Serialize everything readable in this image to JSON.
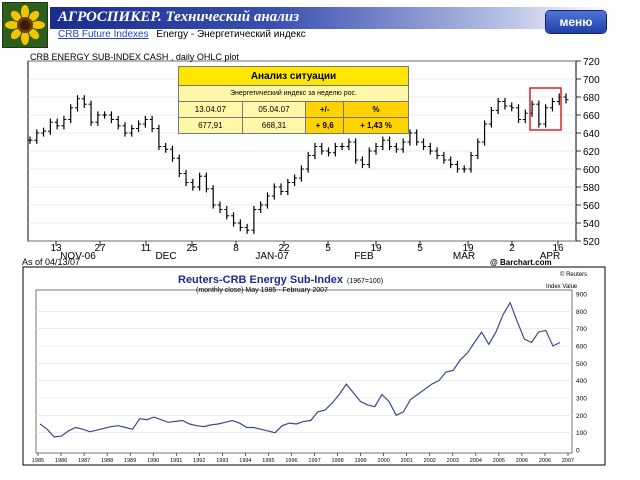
{
  "header": {
    "title": "АГРОСПИКЕР. Технический анализ",
    "menu_label": "меню"
  },
  "subtitle": {
    "link": "CRB Future Indexes",
    "text": "Energy - Энергетический индекс"
  },
  "analysis": {
    "title": "Анализ ситуации",
    "subtitle": "Энергетический индекс за неделю рос.",
    "columns": [
      "13.04.07",
      "05.04.07",
      "+/-",
      "%"
    ],
    "values": [
      "677,91",
      "668,31",
      "+ 9,6",
      "+ 1,43 %"
    ]
  },
  "chart1": {
    "title": "CRB ENERGY SUB-INDEX CASH , daily OHLC plot",
    "as_of": "As of 04/13/07",
    "source": "@ Barchart.com",
    "y_ticks": [
      "720",
      "700",
      "680",
      "660",
      "640",
      "620",
      "600",
      "580",
      "560",
      "540",
      "520"
    ],
    "day_ticks": [
      "13",
      "27",
      "11",
      "25",
      "8",
      "22",
      "5",
      "19",
      "5",
      "19",
      "2",
      "16"
    ],
    "months": [
      "NOV-06",
      "DEC",
      "JAN-07",
      "FEB",
      "MAR",
      "APR"
    ]
  },
  "chart2": {
    "title": "Reuters-CRB Energy Sub-Index",
    "title_suffix": "(1967=100)",
    "subtitle": "(monthly close) May 1985 - February 2007",
    "brand": "© Reuters",
    "y_axis_label": "Index Value",
    "y_ticks": [
      "900",
      "800",
      "700",
      "600",
      "500",
      "400",
      "300",
      "200",
      "100",
      "0"
    ],
    "years": [
      "1985",
      "1986",
      "1987",
      "1988",
      "1989",
      "1990",
      "1991",
      "1992",
      "1993",
      "1994",
      "1995",
      "1996",
      "1997",
      "1998",
      "1999",
      "2000",
      "2001",
      "2002",
      "2003",
      "2004",
      "2005",
      "2006",
      "2006",
      "2007"
    ]
  },
  "chart_data": [
    {
      "type": "line",
      "title": "CRB ENERGY SUB-INDEX CASH , daily OHLC plot",
      "ylim": [
        520,
        720
      ],
      "series": [
        {
          "values": [
            632,
            640,
            642,
            652,
            648,
            655,
            668,
            678,
            672,
            652,
            660,
            660,
            655,
            648,
            640,
            645,
            650,
            655,
            645,
            625,
            622,
            612,
            595,
            585,
            580,
            592,
            578,
            560,
            555,
            548,
            540,
            535,
            532,
            555,
            560,
            570,
            580,
            575,
            585,
            590,
            600,
            615,
            625,
            620,
            618,
            625,
            625,
            630,
            610,
            605,
            620,
            625,
            632,
            625,
            622,
            630,
            640,
            630,
            625,
            620,
            615,
            610,
            605,
            600,
            600,
            615,
            630,
            650,
            665,
            675,
            670,
            668,
            655,
            662,
            672,
            650,
            668,
            675,
            680,
            677
          ]
        }
      ]
    },
    {
      "type": "line",
      "title": "Reuters-CRB Energy Sub-Index",
      "ylim": [
        0,
        900
      ],
      "series": [
        {
          "values": [
            150,
            120,
            75,
            80,
            110,
            130,
            120,
            105,
            115,
            125,
            135,
            140,
            130,
            120,
            180,
            175,
            190,
            175,
            160,
            165,
            170,
            150,
            140,
            135,
            145,
            150,
            160,
            170,
            155,
            130,
            130,
            120,
            110,
            100,
            140,
            155,
            150,
            165,
            170,
            220,
            230,
            270,
            320,
            380,
            330,
            280,
            260,
            250,
            320,
            280,
            200,
            220,
            290,
            320,
            350,
            380,
            400,
            450,
            460,
            520,
            560,
            620,
            680,
            610,
            680,
            780,
            850,
            740,
            640,
            620,
            680,
            690,
            600,
            620
          ]
        }
      ]
    }
  ]
}
